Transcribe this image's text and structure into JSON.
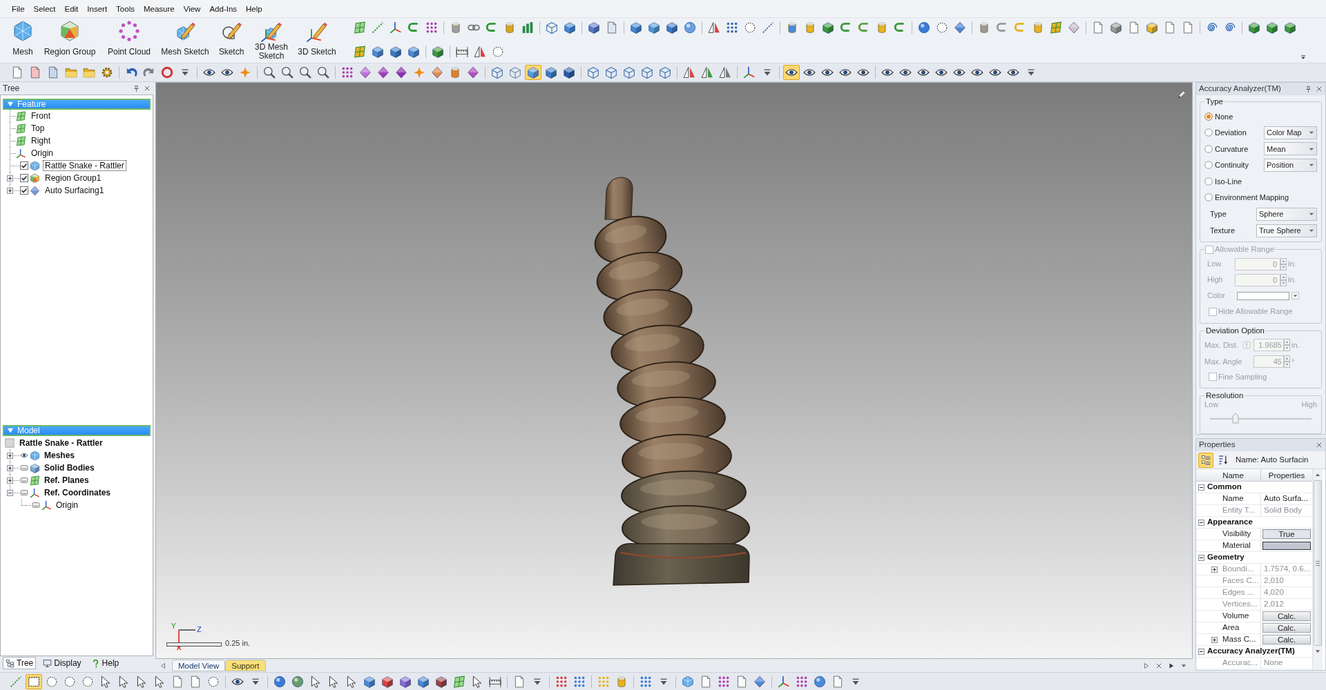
{
  "menu": [
    "File",
    "Select",
    "Edit",
    "Insert",
    "Tools",
    "Measure",
    "View",
    "Add-Ins",
    "Help"
  ],
  "ribbon": {
    "buttons": [
      "Mesh",
      "Region Group",
      "Point Cloud",
      "Mesh Sketch",
      "Sketch",
      "3D Mesh Sketch",
      "3D Sketch"
    ]
  },
  "view_toolbar": {
    "display_modes": [
      {
        "selected": false
      },
      {
        "selected": false
      },
      {
        "selected": true
      },
      {
        "selected": false
      },
      {
        "selected": false
      }
    ],
    "visibility_toggles": [
      {
        "selected": true
      },
      {
        "selected": false
      },
      {
        "selected": false
      },
      {
        "selected": false
      },
      {
        "selected": false
      },
      {
        "selected": false
      },
      {
        "selected": false
      },
      {
        "selected": false
      },
      {
        "selected": false
      },
      {
        "selected": false
      },
      {
        "selected": false
      },
      {
        "selected": false
      },
      {
        "selected": false
      }
    ]
  },
  "tree_panel": {
    "title": "Tree",
    "feature": {
      "header": "Feature",
      "items": [
        {
          "label": "Front",
          "kind": "plane",
          "selected": false
        },
        {
          "label": "Top",
          "kind": "plane",
          "selected": false
        },
        {
          "label": "Right",
          "kind": "plane",
          "selected": false
        },
        {
          "label": "Origin",
          "kind": "axes",
          "selected": false
        },
        {
          "label": "Rattle Snake - Rattler",
          "kind": "mesh",
          "checked": true,
          "selected": true
        },
        {
          "label": "Region Group1",
          "kind": "region",
          "checked": true,
          "expanded": false,
          "selected": false
        },
        {
          "label": "Auto Surfacing1",
          "kind": "surface",
          "checked": true,
          "expanded": false,
          "selected": false
        }
      ]
    },
    "model": {
      "header": "Model",
      "root": "Rattle Snake - Rattler",
      "items": [
        {
          "label": "Meshes",
          "kind": "mesh",
          "visible": true,
          "expanded": false
        },
        {
          "label": "Solid Bodies",
          "kind": "solid",
          "visible": false,
          "expanded": false
        },
        {
          "label": "Ref. Planes",
          "kind": "plane",
          "visible": false,
          "expanded": false
        },
        {
          "label": "Ref. Coordinates",
          "kind": "axes",
          "visible": false,
          "expanded": true,
          "children": [
            {
              "label": "Origin",
              "kind": "axes",
              "visible": false
            }
          ]
        }
      ]
    },
    "tabs": [
      {
        "label": "Tree",
        "selected": true
      },
      {
        "label": "Display",
        "selected": false
      },
      {
        "label": "Help",
        "selected": false
      }
    ]
  },
  "viewport": {
    "axis_labels": [
      "Y",
      "Z"
    ],
    "scale_label": "0.25 in.",
    "tabs": [
      {
        "label": "Model View",
        "selected": true
      },
      {
        "label": "Support",
        "selected": false
      }
    ]
  },
  "accuracy_panel": {
    "title": "Accuracy Analyzer(TM)",
    "type_group": {
      "title": "Type",
      "options": [
        {
          "label": "None",
          "selected": true
        },
        {
          "label": "Deviation",
          "selected": false,
          "dropdown": "Color Map"
        },
        {
          "label": "Curvature",
          "selected": false,
          "dropdown": "Mean"
        },
        {
          "label": "Continuity",
          "selected": false,
          "dropdown": "Position"
        },
        {
          "label": "Iso-Line",
          "selected": false
        },
        {
          "label": "Environment Mapping",
          "selected": false
        }
      ],
      "fields": [
        {
          "label": "Type",
          "value": "Sphere"
        },
        {
          "label": "Texture",
          "value": "True Sphere"
        }
      ]
    },
    "allowable_range": {
      "title": "Allowable Range",
      "checked": false,
      "disabled": true,
      "fields": [
        {
          "label": "Low",
          "kind": "number",
          "value": "0",
          "unit": "in."
        },
        {
          "label": "High",
          "kind": "number",
          "value": "0",
          "unit": "in."
        },
        {
          "label": "Color",
          "kind": "color"
        }
      ],
      "hide_option": {
        "label": "Hide Allowable Range",
        "checked": false
      }
    },
    "deviation_option": {
      "title": "Deviation Option",
      "disabled": true,
      "fields": [
        {
          "label": "Max. Dist.",
          "value": "1.9685",
          "unit": "in.",
          "flag": true
        },
        {
          "label": "Max. Angle",
          "value": "45",
          "unit": "°",
          "flag": false
        }
      ],
      "fine_sampling": {
        "label": "Fine Sampling",
        "checked": false
      }
    },
    "resolution": {
      "title": "Resolution",
      "low": "Low",
      "high": "High",
      "level": 0.25,
      "disabled": true
    }
  },
  "properties_panel": {
    "title": "Properties",
    "view_buttons": [
      {
        "selected": true
      },
      {
        "selected": false
      }
    ],
    "object_name": "Name: Auto Surfacin",
    "columns": [
      "Name",
      "Properties"
    ],
    "sections": [
      {
        "label": "Common",
        "expanded": true,
        "rows": [
          {
            "name": "Name",
            "value": "Auto Surfa...",
            "kind": "text",
            "readonly": false
          },
          {
            "name": "Entity T...",
            "value": "Solid Body",
            "kind": "text",
            "readonly": true
          }
        ]
      },
      {
        "label": "Appearance",
        "expanded": true,
        "rows": [
          {
            "name": "Visibility",
            "value": "True",
            "kind": "choice",
            "readonly": false
          },
          {
            "name": "Material",
            "kind": "swatch",
            "color": "#c3c5d3",
            "readonly": false
          }
        ]
      },
      {
        "label": "Geometry",
        "expanded": true,
        "rows": [
          {
            "name": "Boundi...",
            "value": "1.7574, 0.6...",
            "kind": "text",
            "readonly": true,
            "expanded": false
          },
          {
            "name": "Faces C...",
            "value": "2,010",
            "kind": "text",
            "readonly": true
          },
          {
            "name": "Edges ...",
            "value": "4,020",
            "kind": "text",
            "readonly": true
          },
          {
            "name": "Vertices...",
            "value": "2,012",
            "kind": "text",
            "readonly": true
          },
          {
            "name": "Volume",
            "value": "Calc.",
            "kind": "button",
            "readonly": false
          },
          {
            "name": "Area",
            "value": "Calc.",
            "kind": "button",
            "readonly": false
          },
          {
            "name": "Mass C...",
            "value": "Calc.",
            "kind": "button",
            "readonly": false,
            "expanded": false
          }
        ]
      },
      {
        "label": "Accuracy Analyzer(TM)",
        "expanded": true,
        "rows": [
          {
            "name": "Accurac...",
            "value": "None",
            "kind": "text",
            "readonly": true
          }
        ]
      }
    ]
  },
  "selection_toolbar": {
    "selection_modes": [
      {
        "selected": false
      },
      {
        "selected": true
      },
      {
        "selected": false
      },
      {
        "selected": false
      },
      {
        "selected": false
      },
      {
        "selected": false
      },
      {
        "selected": false
      },
      {
        "selected": false
      },
      {
        "selected": false
      },
      {
        "selected": false
      },
      {
        "selected": false
      },
      {
        "selected": false
      }
    ]
  }
}
